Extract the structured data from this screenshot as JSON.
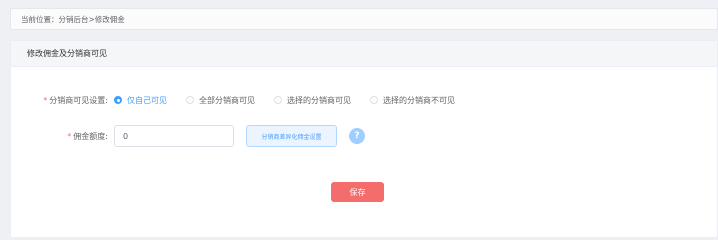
{
  "breadcrumb": {
    "text": "当前位置：分销后台>修改佣金"
  },
  "card": {
    "title": "修改佣金及分销商可见"
  },
  "visibility": {
    "required_mark": "*",
    "label": "分销商可见设置:",
    "options": [
      {
        "label": "仅自己可见",
        "checked": true
      },
      {
        "label": "全部分销商可见",
        "checked": false
      },
      {
        "label": "选择的分销商可见",
        "checked": false
      },
      {
        "label": "选择的分销商不可见",
        "checked": false
      }
    ]
  },
  "commission": {
    "required_mark": "*",
    "label": "佣金额度:",
    "value": "0",
    "diff_button_label": "分销商差异化佣金设置",
    "help_glyph": "?"
  },
  "actions": {
    "save_label": "保存"
  },
  "colors": {
    "primary": "#409eff",
    "danger": "#f56c6c",
    "help": "#a0cfff"
  },
  "icons": {
    "help": "question-circle-icon"
  }
}
